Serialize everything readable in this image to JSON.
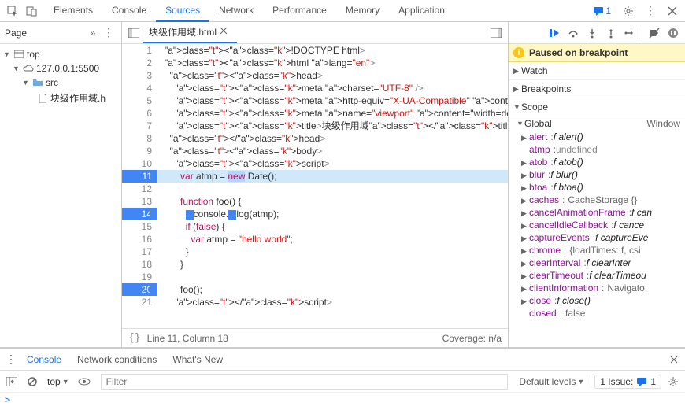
{
  "topTabs": [
    "Elements",
    "Console",
    "Sources",
    "Network",
    "Performance",
    "Memory",
    "Application"
  ],
  "activeTopTab": 2,
  "issuesTop": "1",
  "leftPanel": {
    "title": "Page"
  },
  "tree": {
    "top": "top",
    "host": "127.0.0.1:5500",
    "folder": "src",
    "file": "块级作用域.h"
  },
  "editor": {
    "openFile": "块级作用域.html",
    "lines": [
      "<!DOCTYPE html>",
      "<html lang=\"en\">",
      "  <head>",
      "    <meta charset=\"UTF-8\" />",
      "    <meta http-equiv=\"X-UA-Compatible\" content=\"IE=edge\" />",
      "    <meta name=\"viewport\" content=\"width=device-width, init",
      "    <title>块级作用域</title>",
      "  </head>",
      "  <body>",
      "    <script>",
      "      var atmp = new Date();",
      "",
      "      function foo() {",
      "        console.log(atmp);",
      "        if (false) {",
      "          var atmp = \"hello world\";",
      "        }",
      "      }",
      "",
      "      foo();",
      "    </script>"
    ],
    "breakpoints": [
      11,
      14,
      20
    ],
    "highlighted": 11,
    "statusLeft": "Line 11, Column 18",
    "statusRight": "Coverage: n/a"
  },
  "debugger": {
    "pausedMsg": "Paused on breakpoint",
    "sections": [
      "Watch",
      "Breakpoints",
      "Scope"
    ],
    "globalLabel": "Global",
    "globalRight": "Window",
    "scope": [
      {
        "name": "alert",
        "val": "f alert()",
        "fn": true
      },
      {
        "name": "atmp",
        "val": "undefined",
        "undef": true,
        "noarrow": true
      },
      {
        "name": "atob",
        "val": "f atob()",
        "fn": true
      },
      {
        "name": "blur",
        "val": "f blur()",
        "fn": true
      },
      {
        "name": "btoa",
        "val": "f btoa()",
        "fn": true
      },
      {
        "name": "caches",
        "val": "CacheStorage {}",
        "fn": false
      },
      {
        "name": "cancelAnimationFrame",
        "val": "f can",
        "fn": true
      },
      {
        "name": "cancelIdleCallback",
        "val": "f cance",
        "fn": true
      },
      {
        "name": "captureEvents",
        "val": "f captureEve",
        "fn": true
      },
      {
        "name": "chrome",
        "val": "{loadTimes: f, csi:",
        "fn": false
      },
      {
        "name": "clearInterval",
        "val": "f clearInter",
        "fn": true
      },
      {
        "name": "clearTimeout",
        "val": "f clearTimeou",
        "fn": true
      },
      {
        "name": "clientInformation",
        "val": "Navigato",
        "fn": false
      },
      {
        "name": "close",
        "val": "f close()",
        "fn": true
      },
      {
        "name": "closed",
        "val": "false",
        "fn": false,
        "noarrow": true
      }
    ]
  },
  "drawer": {
    "tabs": [
      "Console",
      "Network conditions",
      "What's New"
    ],
    "activeTab": 0,
    "context": "top",
    "filterPlaceholder": "Filter",
    "levels": "Default levels",
    "issues": "1 Issue:",
    "issuesCount": "1",
    "prompt": ">"
  }
}
